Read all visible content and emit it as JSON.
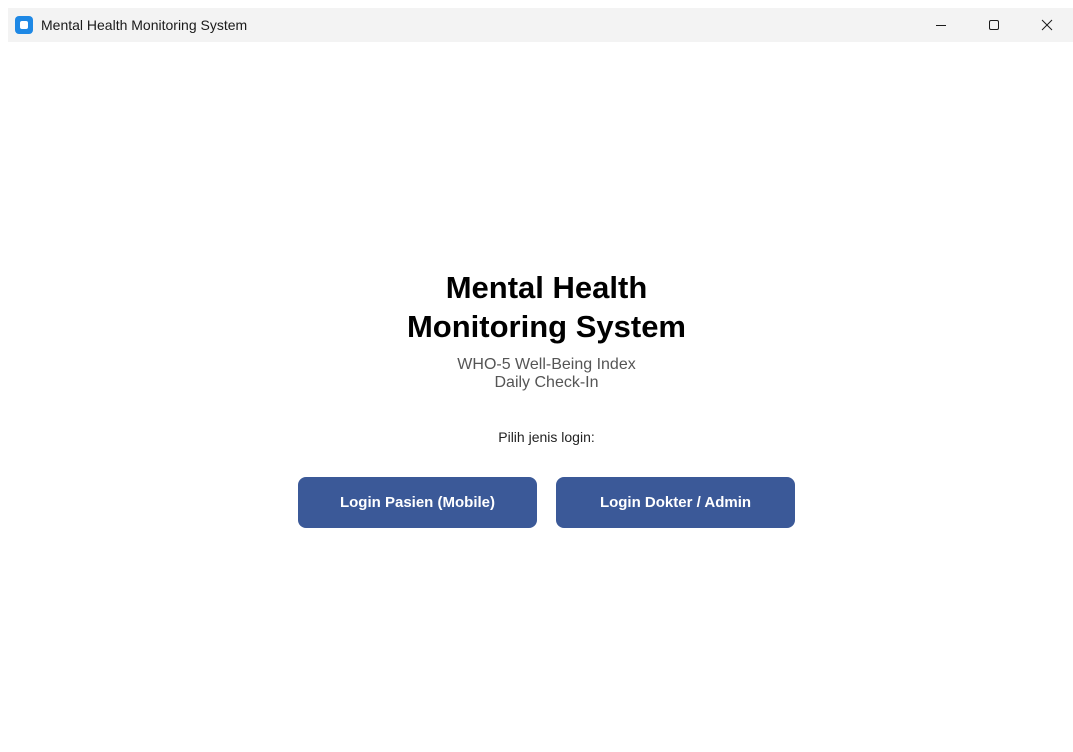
{
  "window": {
    "title": "Mental Health Monitoring System"
  },
  "main": {
    "heading_line1": "Mental Health",
    "heading_line2": "Monitoring System",
    "subtitle_line1": "WHO-5 Well-Being Index",
    "subtitle_line2": "Daily Check-In",
    "prompt": "Pilih jenis login:",
    "buttons": [
      {
        "label": "Login Pasien (Mobile)"
      },
      {
        "label": "Login Dokter / Admin"
      }
    ]
  },
  "colors": {
    "titlebar_bg": "#f3f3f3",
    "app_icon": "#1e88e5",
    "button_bg": "#3b5998",
    "button_text": "#ffffff"
  },
  "icons": {
    "app": "app-icon",
    "minimize": "minimize-icon",
    "maximize": "maximize-icon",
    "close": "close-icon"
  }
}
